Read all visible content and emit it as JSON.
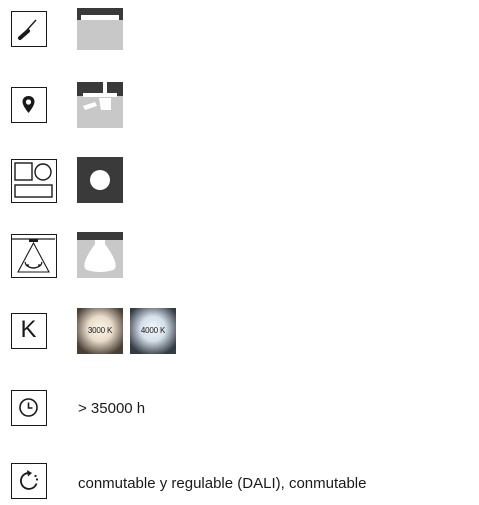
{
  "rows": {
    "mounting": {
      "icon": "screwdriver-icon",
      "swatch": "recessed-ceiling-swatch"
    },
    "location": {
      "icon": "location-pin-icon",
      "swatch": "ceiling-installation-swatch"
    },
    "shape": {
      "icon": "shape-square-round-icon",
      "swatch": "round-shape-swatch"
    },
    "beam": {
      "icon": "beam-angle-icon",
      "swatch": "beam-distribution-swatch"
    },
    "color_temperature": {
      "icon_letter": "K",
      "options": [
        {
          "label": "3000 K",
          "tint": "#f3e8da"
        },
        {
          "label": "4000 K",
          "tint": "#e6eef5"
        }
      ]
    },
    "lifetime": {
      "icon": "clock-icon",
      "value": "> 35000 h"
    },
    "control": {
      "icon": "dimming-arrow-icon",
      "value": "conmutable y regulable (DALI), conmutable"
    }
  },
  "colors": {
    "swatch_dark": "#3a3a3a",
    "swatch_light": "#c8c8c8",
    "icon_stroke": "#1a1a1a"
  }
}
